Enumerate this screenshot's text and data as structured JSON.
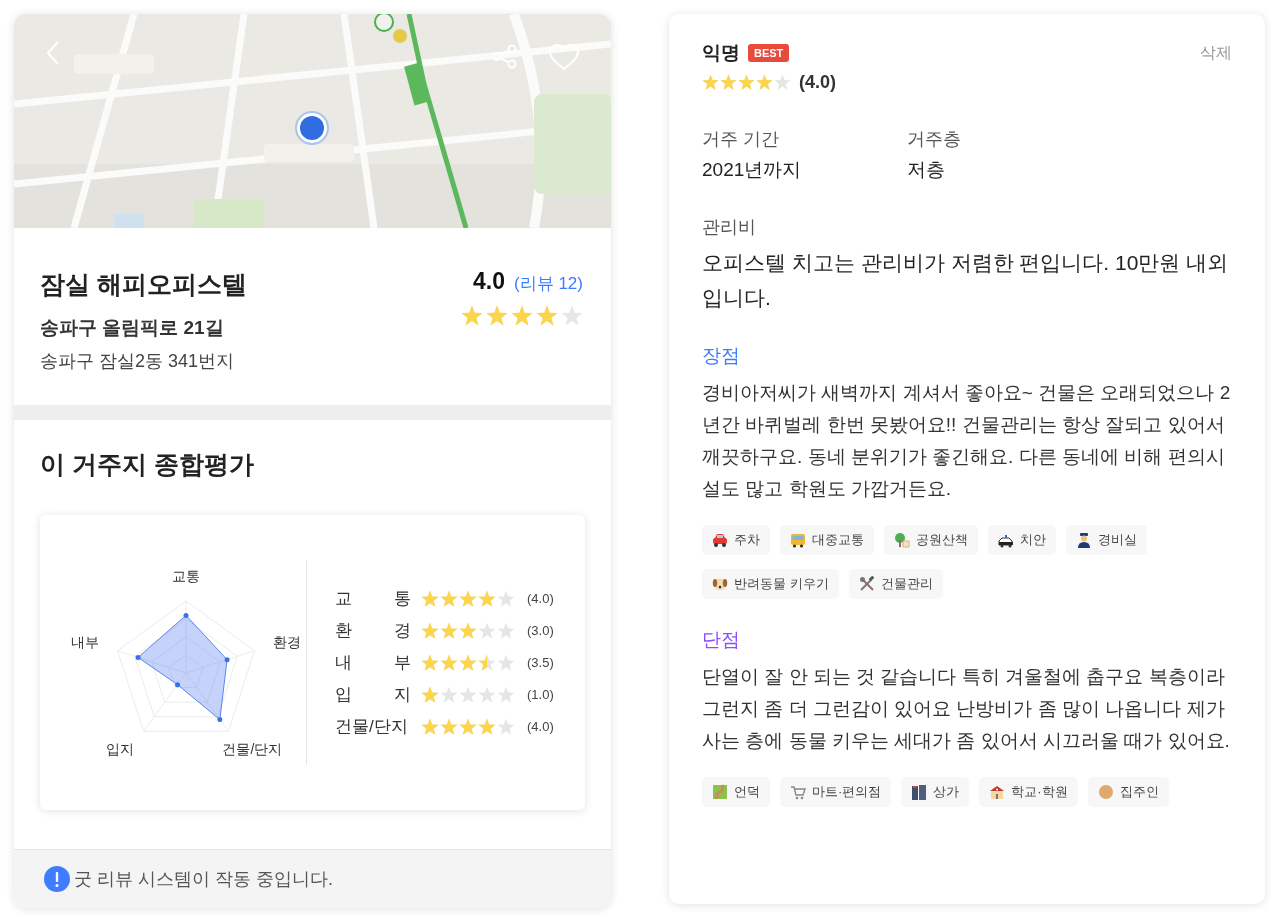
{
  "listing": {
    "name": "잠실 해피오피스텔",
    "road_address": "송파구 올림픽로 21길",
    "lot_address": "송파구 잠실2동 341번지",
    "score": "4.0",
    "review_count": "(리뷰 12)",
    "stars": 4
  },
  "overall": {
    "title": "이 거주지 종합평가",
    "radar_axes": [
      {
        "label": "교통"
      },
      {
        "label": "환경"
      },
      {
        "label": "건물/단지"
      },
      {
        "label": "입지"
      },
      {
        "label": "내부"
      }
    ],
    "ratings": [
      {
        "label": "교 통",
        "stars": 4,
        "score": "(4.0)"
      },
      {
        "label": "환 경",
        "stars": 3,
        "score": "(3.0)"
      },
      {
        "label": "내 부",
        "stars": 3.5,
        "score": "(3.5)"
      },
      {
        "label": "입 지",
        "stars": 1,
        "score": "(1.0)"
      },
      {
        "label": "건물/단지",
        "stars": 4,
        "score": "(4.0)"
      }
    ]
  },
  "notice": {
    "text": "굿 리뷰 시스템이 작동 중입니다."
  },
  "review": {
    "author": "익명",
    "badge": "BEST",
    "delete": "삭제",
    "stars": 4,
    "score": "(4.0)",
    "details": [
      {
        "label": "거주 기간",
        "value": "2021년까지"
      },
      {
        "label": "거주층",
        "value": "저층"
      }
    ],
    "fee": {
      "label": "관리비",
      "text": "오피스텔 치고는 관리비가 저렴한 편입니다. 10만원 내외입니다."
    },
    "sections": [
      {
        "kind": "pros",
        "title": "장점",
        "text": "경비아저씨가 새벽까지 계셔서 좋아요~ 건물은 오래되었으나 2년간 바퀴벌레 한번 못봤어요!! 건물관리는 항상 잘되고 있어서 깨끗하구요. 동네 분위기가 좋긴해요. 다른 동네에 비해 편의시설도 많고 학원도 가깝거든요.",
        "tags": [
          "주차",
          "대중교통",
          "공원산책",
          "치안",
          "경비실",
          "반려동물 키우기",
          "건물관리"
        ]
      },
      {
        "kind": "cons",
        "title": "단점",
        "text": "단열이 잘 안 되는 것 같습니다 특히 겨울철에 춥구요 복층이라 그런지 좀 더 그런감이 있어요 난방비가 좀 많이 나옵니다 제가 사는 층에 동물 키우는 세대가 좀 있어서 시끄러울 때가 있어요.",
        "tags": [
          "언덕",
          "마트·편의점",
          "상가",
          "학교·학원",
          "집주인"
        ]
      }
    ]
  }
}
